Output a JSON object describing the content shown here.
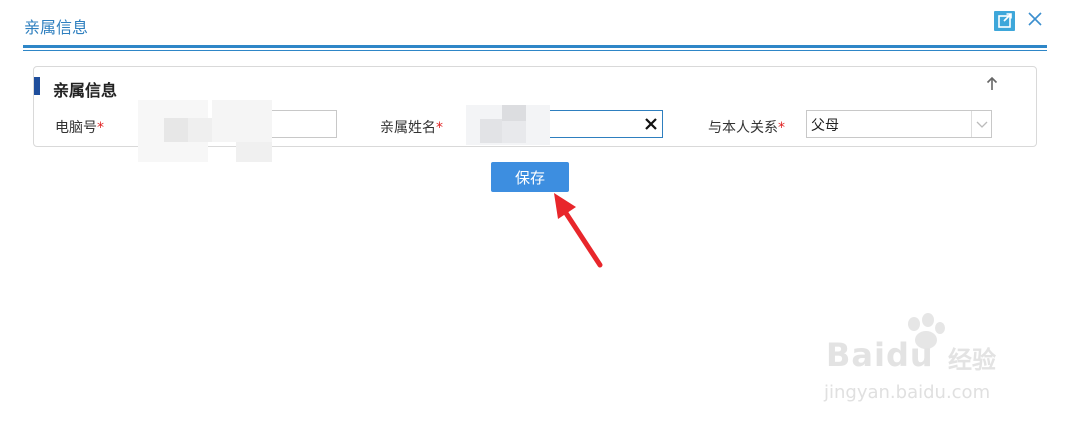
{
  "dialog": {
    "title": "亲属信息"
  },
  "section": {
    "title": "亲属信息"
  },
  "fields": {
    "computer_no": {
      "label": "电脑号",
      "required_mark": "*"
    },
    "relative_name": {
      "label": "亲属姓名",
      "required_mark": "*"
    },
    "relation": {
      "label": "与本人关系",
      "required_mark": "*",
      "value": "父母"
    }
  },
  "actions": {
    "save_label": "保存"
  },
  "watermark": {
    "brand": "Baidu",
    "brand_cn": "经验",
    "url": "jingyan.baidu.com"
  },
  "colors": {
    "accent": "#2e86c7",
    "save_button": "#3d8ee0",
    "required": "#e02020",
    "section_accent": "#1f4e9c",
    "annotation_arrow": "#e8262b"
  },
  "icons": {
    "popout": "popout-icon",
    "close": "close-icon",
    "collapse": "arrow-up-icon",
    "clear": "clear-x-icon",
    "dropdown": "chevron-down-icon"
  }
}
